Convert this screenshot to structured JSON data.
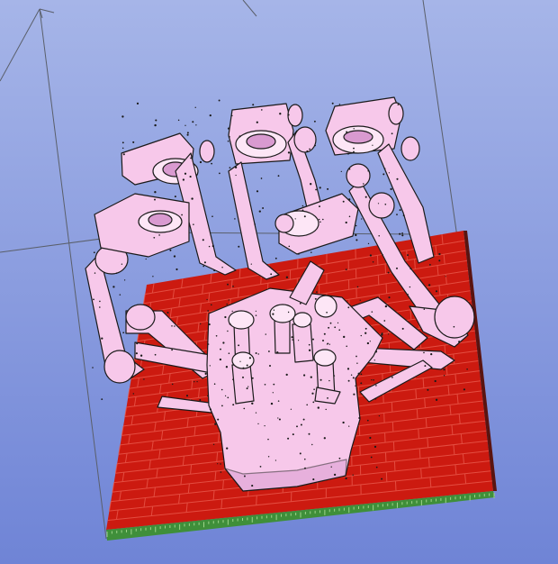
{
  "app": {
    "view": "3d-print-preview",
    "description_free": true
  },
  "colors": {
    "background_top": "#a6b5e8",
    "background_bottom": "#6f84d6",
    "bed_fill": "#cc1a10",
    "bed_grid": "#e8574a",
    "bed_edge_green": "#3f8f3a",
    "bed_edge_dark": "#5a1410",
    "model_fill": "#f7c8ea",
    "model_highlight": "#fde6f6",
    "model_shadow": "#d99ad0",
    "outline": "#1a1a1a",
    "axis_line": "#5a5f6a"
  },
  "icons": [
    "build-volume-frame",
    "print-bed",
    "robot-hand-model"
  ]
}
